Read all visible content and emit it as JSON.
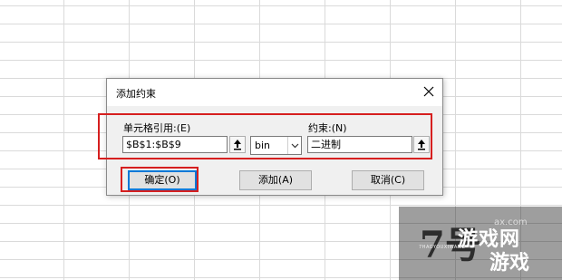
{
  "dialog": {
    "title": "添加约束",
    "cell_ref_label": "单元格引用:(E)",
    "cell_ref_value": "$B$1:$B$9",
    "operator_value": "bin",
    "constraint_label": "约束:(N)",
    "constraint_value": "二进制",
    "ok_label": "确定(O)",
    "add_label": "添加(A)",
    "cancel_label": "取消(C)"
  },
  "watermark": {
    "glyph": "7号",
    "small_text": "7HAOYOUXIWANG",
    "brand_line1": "游戏网",
    "brand_line2": "游戏",
    "url_fragment": "ax.com"
  },
  "colors": {
    "highlight": "#d61f1f",
    "default_button_border": "#0078d7",
    "dialog_bg": "#f0f0f0"
  },
  "icons": [
    "close-icon",
    "collapse-dialog-icon",
    "chevron-down-icon"
  ]
}
